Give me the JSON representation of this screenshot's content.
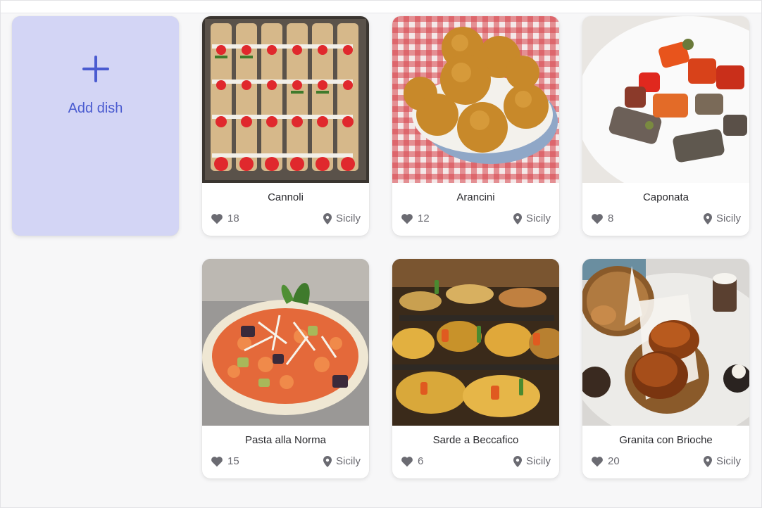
{
  "add_card": {
    "label": "Add dish",
    "icon": "plus-icon",
    "accent": "#4a5bd0",
    "background": "#d3d5f5"
  },
  "dishes": [
    {
      "name": "Cannoli",
      "likes": "18",
      "location": "Sicily"
    },
    {
      "name": "Arancini",
      "likes": "12",
      "location": "Sicily"
    },
    {
      "name": "Caponata",
      "likes": "8",
      "location": "Sicily"
    },
    {
      "name": "Pasta alla Norma",
      "likes": "15",
      "location": "Sicily"
    },
    {
      "name": "Sarde a Beccafico",
      "likes": "6",
      "location": "Sicily"
    },
    {
      "name": "Granita con Brioche",
      "likes": "20",
      "location": "Sicily"
    }
  ],
  "icons": {
    "like": "heart-icon",
    "location": "map-pin-icon"
  }
}
